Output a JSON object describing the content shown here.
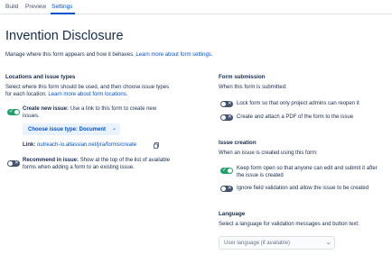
{
  "tabs": [
    {
      "label": "Build"
    },
    {
      "label": "Preview"
    },
    {
      "label": "Settings",
      "active": true
    }
  ],
  "page": {
    "title": "Invention Disclosure",
    "subtitle": "Manage where this form appears and how it behaves.",
    "subtitle_link": "Learn more about form settings."
  },
  "locations": {
    "heading": "Locations and issue types",
    "description_line1": "Select where this form should be used, and then choose issue types",
    "description_line2": "for each location.",
    "description_link": "Learn more about form locations.",
    "create_new_issue": {
      "toggle_on": true,
      "label_bold": "Create new issue:",
      "label_line1": "Use a link to this form to create new",
      "label_line2": "issues."
    },
    "issue_type_button": "Choose issue type: Document",
    "link_label": "Link:",
    "link_url": "outreach-io.atlassian.net/jira/forms/create",
    "recommend_in_issue": {
      "toggle_on": false,
      "label_bold": "Recommend in issue:",
      "label_line1": "Show at the top of the list of available",
      "label_line2": "forms when adding a form to an existing issue."
    }
  },
  "form_submission": {
    "heading": "Form submission",
    "description": "When this form is submitted:",
    "options": [
      {
        "label": "Lock form so that only project admins can reopen it",
        "toggle_on": false
      },
      {
        "label": "Create and attach a PDF of the form to the issue",
        "toggle_on": false
      }
    ]
  },
  "issue_creation": {
    "heading": "Issue creation",
    "description": "When an issue is created using this form:",
    "options": [
      {
        "label_line1": "Keep form open so that anyone can edit and submit it after",
        "label_line2": "the issue is created",
        "toggle_on": true
      },
      {
        "label_line1": "Ignore field validation and allow the issue to be created",
        "label_line2": "",
        "toggle_on": false
      }
    ]
  },
  "language": {
    "heading": "Language",
    "description": "Select a language for validation messages and button text:",
    "select_placeholder": "User language (if available)"
  },
  "icons": {
    "toggle_on": "check-icon",
    "toggle_off": "cross-icon",
    "button_chevron": "chevron-down-icon",
    "copy": "copy-icon"
  },
  "colors": {
    "accent": "#0052cc",
    "toggle_on": "#22a06b",
    "toggle_off": "#44546f",
    "text": "#172b4d"
  }
}
